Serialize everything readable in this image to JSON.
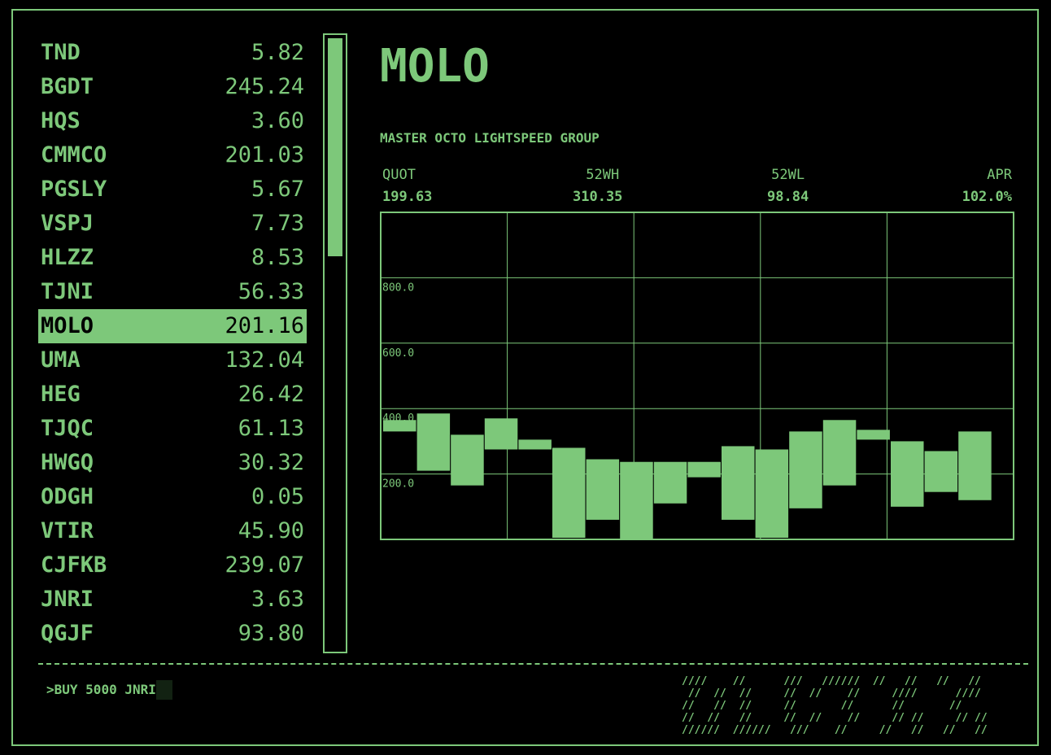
{
  "watchlist": [
    {
      "symbol": "TND",
      "price": "5.82"
    },
    {
      "symbol": "BGDT",
      "price": "245.24"
    },
    {
      "symbol": "HQS",
      "price": "3.60"
    },
    {
      "symbol": "CMMCO",
      "price": "201.03"
    },
    {
      "symbol": "PGSLY",
      "price": "5.67"
    },
    {
      "symbol": "VSPJ",
      "price": "7.73"
    },
    {
      "symbol": "HLZZ",
      "price": "8.53"
    },
    {
      "symbol": "TJNI",
      "price": "56.33"
    },
    {
      "symbol": "MOLO",
      "price": "201.16",
      "selected": true
    },
    {
      "symbol": "UMA",
      "price": "132.04"
    },
    {
      "symbol": "HEG",
      "price": "26.42"
    },
    {
      "symbol": "TJQC",
      "price": "61.13"
    },
    {
      "symbol": "HWGQ",
      "price": "30.32"
    },
    {
      "symbol": "ODGH",
      "price": "0.05"
    },
    {
      "symbol": "VTIR",
      "price": "45.90"
    },
    {
      "symbol": "CJFKB",
      "price": "239.07"
    },
    {
      "symbol": "JNRI",
      "price": "3.63"
    },
    {
      "symbol": "QGJF",
      "price": "93.80"
    }
  ],
  "detail": {
    "ticker": "MOLO",
    "company": "MASTER OCTO LIGHTSPEED GROUP",
    "stats": [
      {
        "label": "QUOT",
        "value": "199.63"
      },
      {
        "label": "52WH",
        "value": "310.35"
      },
      {
        "label": "52WL",
        "value": "98.84"
      },
      {
        "label": "APR",
        "value": "102.0%"
      }
    ]
  },
  "chart_data": {
    "type": "candlestick",
    "y_ticks": [
      "800.0",
      "600.0",
      "400.0",
      "200.0"
    ],
    "ylim": [
      0,
      1000
    ],
    "grid": true,
    "candles": [
      [
        330,
        365
      ],
      [
        210,
        385
      ],
      [
        165,
        320
      ],
      [
        275,
        370
      ],
      [
        275,
        305
      ],
      [
        5,
        280
      ],
      [
        60,
        245
      ],
      [
        0,
        237
      ],
      [
        110,
        237
      ],
      [
        190,
        237
      ],
      [
        60,
        285
      ],
      [
        5,
        275
      ],
      [
        95,
        330
      ],
      [
        165,
        365
      ],
      [
        305,
        335
      ],
      [
        100,
        300
      ],
      [
        145,
        270
      ],
      [
        120,
        330
      ]
    ],
    "colors": {
      "accent": "#7dc87a",
      "background": "#000000"
    }
  },
  "command": {
    "prompt": ">",
    "text": "BUY 5000 JNRI"
  },
  "logo_text": "////    //      ///   //////  //   //   //   //\n //  //  //     //  //    //     ////      ////\n//   //  //     //       //      //       //\n//  //   //     //  //    //     // //     // //\n//////  //////   ///    //     //   //   //   //"
}
